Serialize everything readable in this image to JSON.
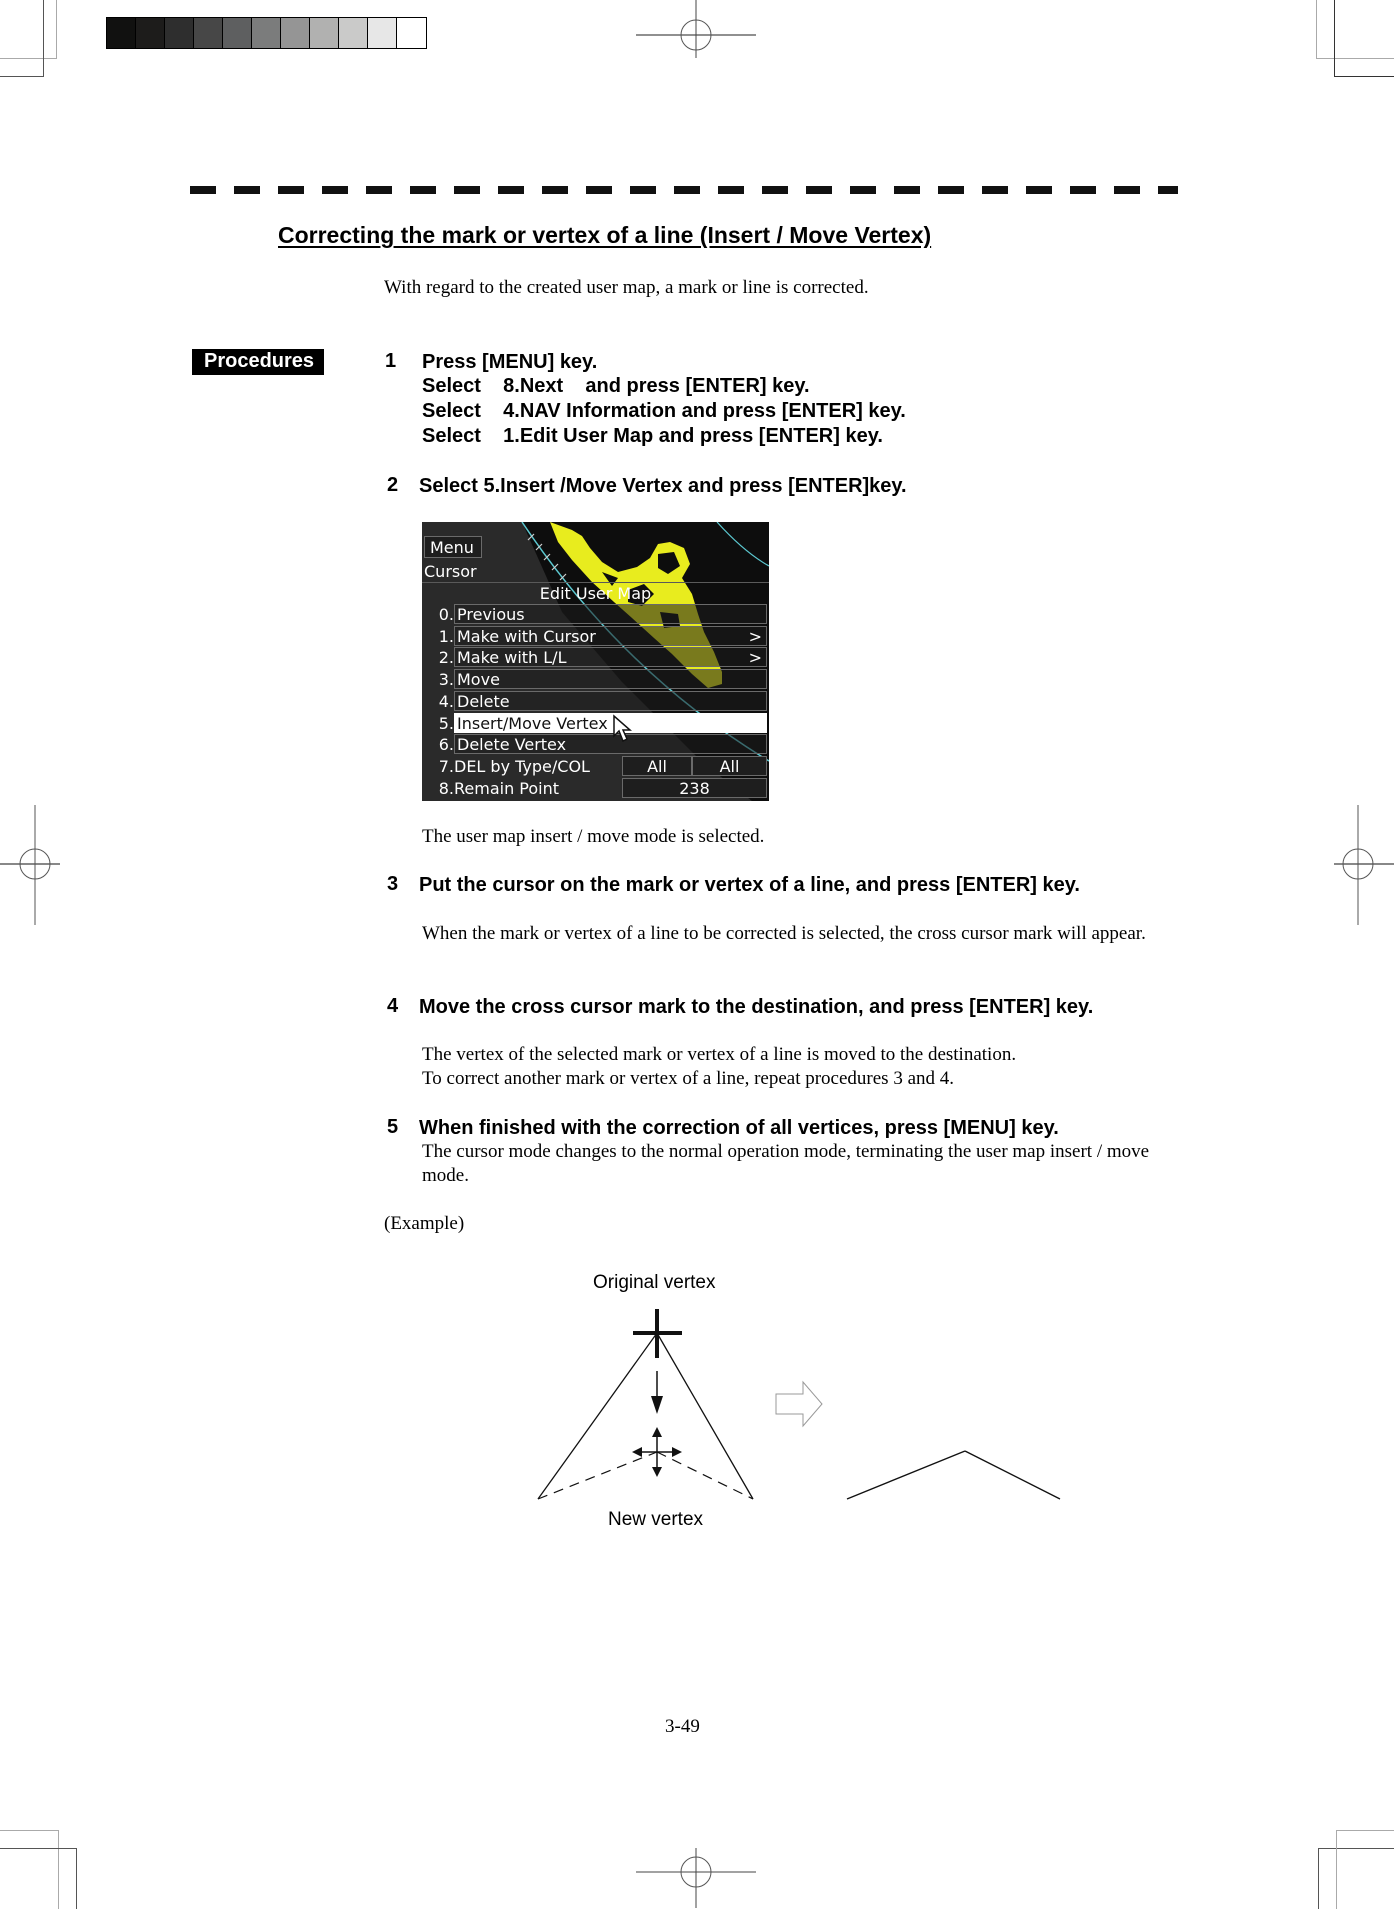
{
  "print_marks": {
    "gray_scale_swatches": [
      "#111110",
      "#1d1c1b",
      "#2e2e2e",
      "#474747",
      "#5e5f60",
      "#7b7c7c",
      "#959595",
      "#b1b1b0",
      "#cacac9",
      "#e7e7e7",
      "#ffffff"
    ]
  },
  "header": {
    "title": "Correcting the mark or vertex of a line (Insert / Move Vertex)",
    "intro": "With regard to the created user map, a mark or line is corrected."
  },
  "procedures_badge": "Procedures",
  "steps": [
    {
      "num": "1",
      "lines": [
        "Press [MENU] key.",
        "Select    8.Next    and press [ENTER] key.",
        "Select    4.NAV Information and press [ENTER] key.",
        "Select    1.Edit User Map and press [ENTER] key."
      ]
    },
    {
      "num": "2",
      "lines": [
        "Select 5.Insert /Move Vertex and press [ENTER]key."
      ],
      "note": "The user map insert / move mode is selected."
    },
    {
      "num": "3",
      "lines": [
        "Put the cursor on the mark or vertex of a line, and press [ENTER] key."
      ],
      "note": "When the mark or vertex of a line to be corrected is selected, the cross cursor mark will appear."
    },
    {
      "num": "4",
      "lines": [
        "Move the cross cursor mark to the destination, and press [ENTER] key."
      ],
      "note_lines": [
        "The vertex of the selected mark or vertex of a line is moved to the destination.",
        "To correct another mark or vertex of a line, repeat procedures 3 and 4."
      ]
    },
    {
      "num": "5",
      "lines": [
        "When finished with the correction of all vertices, press [MENU] key."
      ],
      "note": "The cursor mode changes to the normal operation mode, terminating the user map insert / move mode."
    }
  ],
  "screenshot": {
    "menu_tag": "Menu",
    "cursor_label": "Cursor",
    "panel_title": "Edit User Map",
    "items": [
      {
        "num": "0.",
        "label": "Previous",
        "chevron": ""
      },
      {
        "num": "1.",
        "label": "Make with Cursor",
        "chevron": ">"
      },
      {
        "num": "2.",
        "label": "Make with L/L",
        "chevron": ">"
      },
      {
        "num": "3.",
        "label": "Move",
        "chevron": ""
      },
      {
        "num": "4.",
        "label": "Delete",
        "chevron": ""
      },
      {
        "num": "5.",
        "label": "Insert/Move Vertex",
        "chevron": "",
        "selected": true
      },
      {
        "num": "6.",
        "label": "Delete Vertex",
        "chevron": ""
      }
    ],
    "del_by_type": {
      "num": "7.",
      "label": "DEL by Type/COL",
      "type_value": "All",
      "col_value": "All"
    },
    "remain_point": {
      "num": "8.",
      "label": "Remain Point",
      "value": "238"
    },
    "colors": {
      "land": "#e8ec1e",
      "range_ring": "#5cc8d0",
      "background": "#2a2a2a"
    }
  },
  "example": {
    "label": "(Example)",
    "original_vertex_label": "Original vertex",
    "new_vertex_label": "New vertex"
  },
  "footer": {
    "page_number": "3-49"
  }
}
